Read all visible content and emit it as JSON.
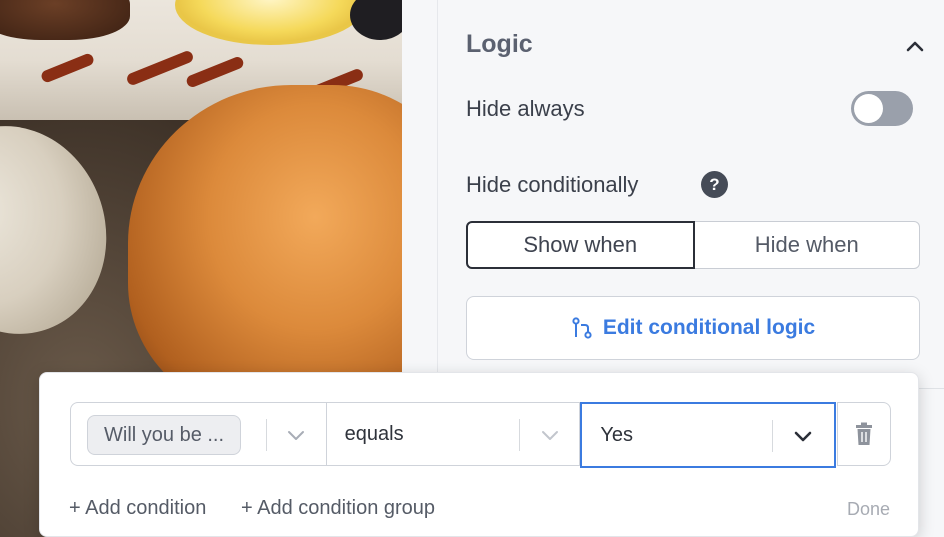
{
  "panel": {
    "section_title": "Logic",
    "hide_always_label": "Hide always",
    "hide_always_on": false,
    "hide_conditionally_label": "Hide conditionally",
    "help_icon_glyph": "?",
    "segment": {
      "show_when": "Show when",
      "hide_when": "Hide when",
      "selected": "show_when"
    },
    "edit_logic_label": "Edit conditional logic",
    "accent_color": "#3b7be0"
  },
  "condition": {
    "field": "Will you be ...",
    "operator": "equals",
    "value": "Yes"
  },
  "actions": {
    "add_condition": "+ Add condition",
    "add_condition_group": "+ Add condition group",
    "done": "Done"
  },
  "icons": [
    "chevron-up-icon",
    "help-icon",
    "branch-icon",
    "chevron-down-icon",
    "trash-icon"
  ]
}
